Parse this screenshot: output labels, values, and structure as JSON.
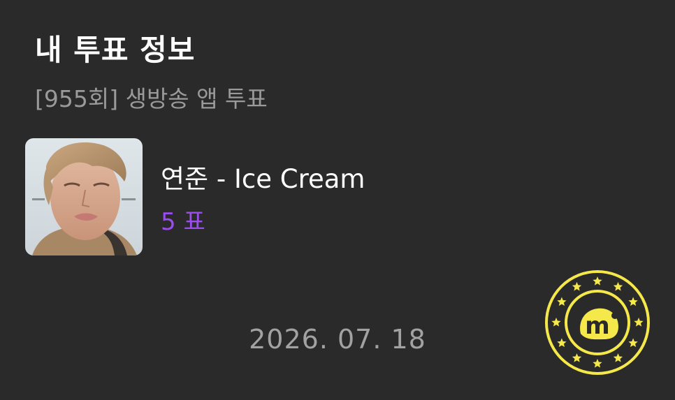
{
  "header": {
    "title": "내 투표 정보",
    "subtitle": "[955회] 생방송 앱 투표"
  },
  "vote_entry": {
    "thumbnail_icon": "album-cover-photo",
    "song": "연준 - Ice Cream",
    "votes": "5 표"
  },
  "footer": {
    "date": "2026. 07. 18"
  },
  "stamp": {
    "icon": "m-star-coin-seal",
    "color": "#f5e84a"
  },
  "colors": {
    "background": "#2a2a2a",
    "accent": "#9b4df0",
    "muted_text": "#9a9a9a"
  }
}
